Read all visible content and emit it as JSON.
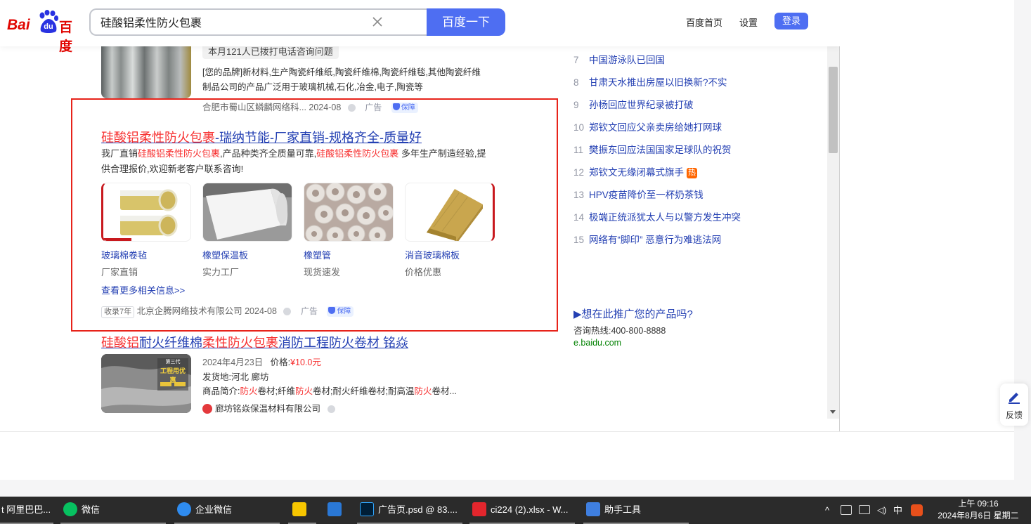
{
  "header": {
    "logo_left": "Bai",
    "logo_du": "du",
    "logo_right": "百度",
    "search_value": "硅酸铝柔性防火包裹",
    "search_button": "百度一下",
    "nav_home": "百度首页",
    "nav_settings": "设置",
    "login": "登录"
  },
  "result_top": {
    "call_badge": "本月121人已拨打电话咨询问题",
    "desc_line1": "[您的品牌]新材料,生产陶瓷纤维纸,陶瓷纤维棉,陶瓷纤维毯,其他陶瓷纤维",
    "desc_line2": "制品公司的产品广泛用于玻璃机械,石化,冶金,电子,陶瓷等",
    "source": "合肥市蜀山区鳞麟网络科... 2024-08",
    "ad_label": "广告",
    "guarantee": "保障"
  },
  "ad": {
    "title_em": "硅酸铝柔性防火包裹",
    "title_rest": "-瑞纳节能-厂家直销-规格齐全-质量好",
    "desc_a": "我厂直销",
    "desc_em1": "硅酸铝柔性防火包裹",
    "desc_b": ",产品种类齐全质量可靠,",
    "desc_em2": "硅酸铝柔性防火包裹",
    "desc_c": " 多年生产制造经验,提供合理报价,欢迎新老客户联系咨询!",
    "products": [
      {
        "name": "玻璃棉卷毡",
        "sub": "厂家直销"
      },
      {
        "name": "橡塑保温板",
        "sub": "实力工厂"
      },
      {
        "name": "橡塑管",
        "sub": "现货速发"
      },
      {
        "name": "消音玻璃棉板",
        "sub": "价格优惠"
      }
    ],
    "more": "查看更多相关信息>>",
    "age": "收录7年",
    "source": "北京企腾网络技术有限公司 2024-08",
    "ad_label": "广告",
    "guarantee": "保障"
  },
  "result3": {
    "title_em1": "硅酸铝",
    "title_a": "耐火纤维棉",
    "title_em2": "柔性防火包裹",
    "title_b": "消防工程防火卷材 铭焱",
    "img_text1": "第三代",
    "img_text2": "工程用优惠",
    "date": "2024年4月23日",
    "price_label": "价格:",
    "price": "¥10.0元",
    "origin": "发货地:河北 廊坊",
    "intro_a": "商品简介:",
    "intro_em1": "防火",
    "intro_b": "卷材;纤维",
    "intro_em2": "防火",
    "intro_c": "卷材;耐火纤维卷材;耐高温",
    "intro_em3": "防火",
    "intro_d": "卷材...",
    "company": "廊坊铭焱保温材料有限公司"
  },
  "hot_list": [
    {
      "rank": "7",
      "text": "中国游泳队已回国",
      "badge": ""
    },
    {
      "rank": "8",
      "text": "甘肃天水推出房屋以旧换新?不实",
      "badge": ""
    },
    {
      "rank": "9",
      "text": "孙杨回应世界纪录被打破",
      "badge": ""
    },
    {
      "rank": "10",
      "text": "郑钦文回应父亲卖房给她打网球",
      "badge": ""
    },
    {
      "rank": "11",
      "text": "樊振东回应法国国家足球队的祝贺",
      "badge": ""
    },
    {
      "rank": "12",
      "text": "郑钦文无缘闭幕式旗手",
      "badge": "热"
    },
    {
      "rank": "13",
      "text": "HPV疫苗降价至一杯奶茶钱",
      "badge": ""
    },
    {
      "rank": "14",
      "text": "极端正统派犹太人与以警方发生冲突",
      "badge": ""
    },
    {
      "rank": "15",
      "text": "网络有“脚印” 恶意行为难逃法网",
      "badge": ""
    }
  ],
  "promo": {
    "title": "▶想在此推广您的产品吗?",
    "phone": "咨询热线:400-800-8888",
    "url": "e.baidu.com"
  },
  "feedback": "反馈",
  "taskbar": {
    "items": [
      {
        "label": "t 阿里巴巴..."
      },
      {
        "label": "微信"
      },
      {
        "label": "企业微信"
      },
      {
        "label": ""
      },
      {
        "label": ""
      },
      {
        "label": "广告页.psd @ 83...."
      },
      {
        "label": "ci224 (2).xlsx - W..."
      },
      {
        "label": "助手工具"
      }
    ],
    "ime": "中",
    "time": "上午 09:16",
    "date": "2024年8月6日 星期二"
  },
  "colors": {
    "accent": "#4e6ef2",
    "link": "#2440b3",
    "highlight": "#f73131",
    "ad_frame": "#e7231a",
    "taskbar": "#2b2b2b"
  }
}
